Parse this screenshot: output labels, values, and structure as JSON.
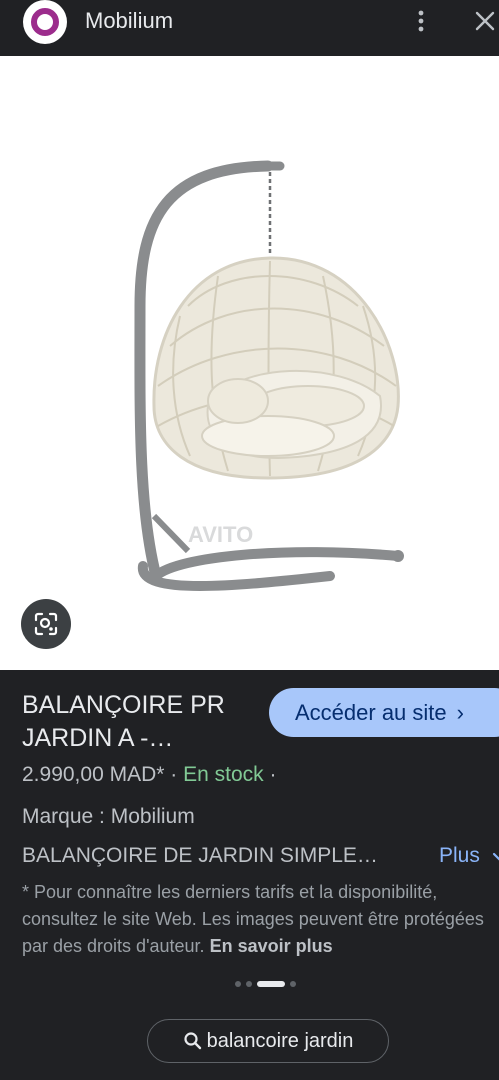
{
  "header": {
    "site_name": "Mobilium",
    "logo_icon": "mobilium-logo",
    "menu_icon": "more-vert-icon",
    "close_icon": "close-icon"
  },
  "image": {
    "watermark": "AVITO",
    "subject": "hanging egg swing chair"
  },
  "product": {
    "title": "BALANÇOIRE PR JARDIN A -…",
    "visit_label": "Accéder au site",
    "price": "2.990,00 MAD*",
    "separator": " · ",
    "stock": "En stock",
    "trailing_separator": " ·",
    "brand": "Marque : Mobilium",
    "description": "BALANÇOIRE DE JARDIN SIMPLE…",
    "more_label": "Plus",
    "disclaimer": "* Pour connaître les derniers tarifs et la disponibilité, consultez le site Web. Les images peuvent être protégées par des droits d'auteur.",
    "learn_more": "En savoir plus"
  },
  "carousel": {
    "count": 4,
    "active_index": 2
  },
  "search_chip": {
    "label": "balancoire jardin"
  },
  "colors": {
    "background": "#202124",
    "accent_button": "#a8c7fa",
    "stock_green": "#81c995",
    "link_blue": "#8ab4f8",
    "logo_purple": "#9c2c8c"
  }
}
